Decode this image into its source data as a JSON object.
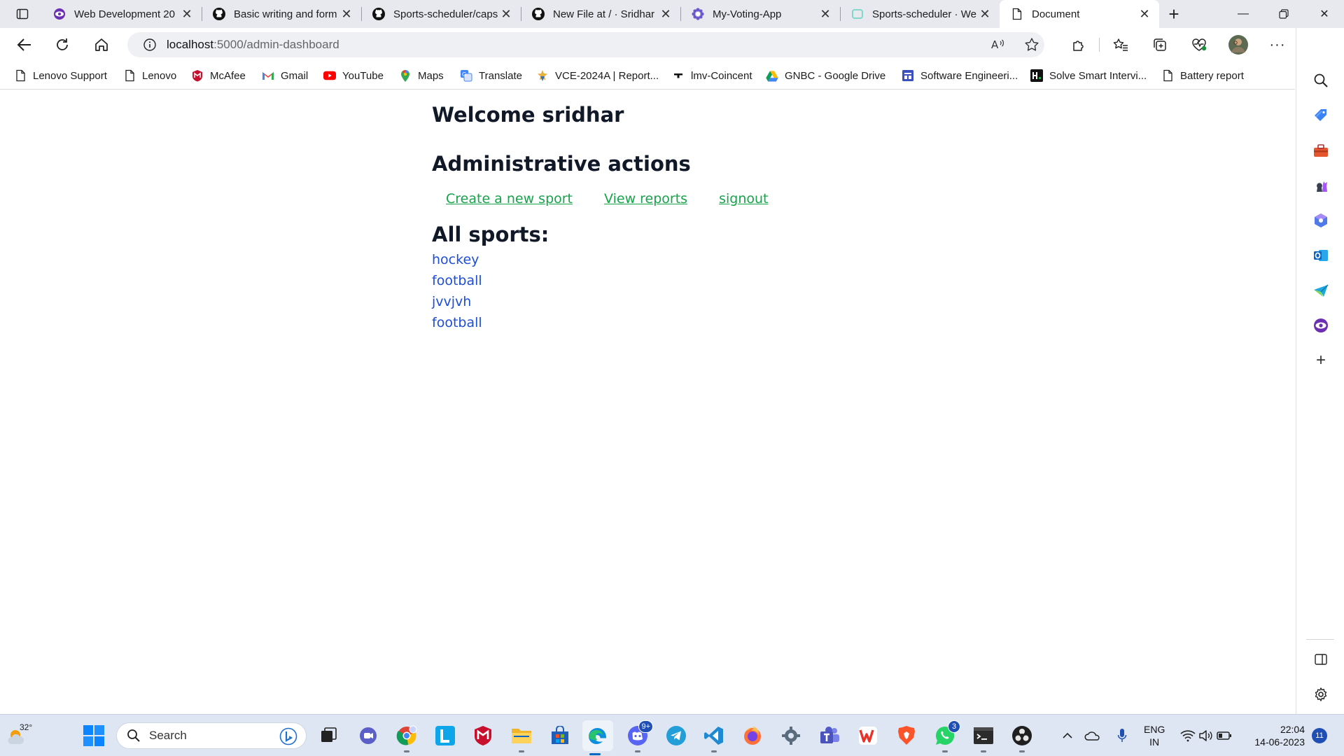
{
  "browser": {
    "tabs": [
      {
        "title": "Web Development 20",
        "icon": "eye-icon",
        "active": false
      },
      {
        "title": "Basic writing and form",
        "icon": "github-icon",
        "active": false
      },
      {
        "title": "Sports-scheduler/caps",
        "icon": "github-icon",
        "active": false
      },
      {
        "title": "New File at / · Sridhar",
        "icon": "github-icon",
        "active": false
      },
      {
        "title": "My-Voting-App",
        "icon": "gear-flower-icon",
        "active": false
      },
      {
        "title": "Sports-scheduler · We",
        "icon": "render-icon",
        "active": false
      },
      {
        "title": "Document",
        "icon": "page-icon",
        "active": true
      }
    ],
    "address": {
      "host": "localhost",
      "rest": ":5000/admin-dashboard"
    },
    "favorites": [
      {
        "label": "Lenovo Support",
        "icon": "page-icon"
      },
      {
        "label": "Lenovo",
        "icon": "page-icon"
      },
      {
        "label": "McAfee",
        "icon": "mcafee-icon"
      },
      {
        "label": "Gmail",
        "icon": "gmail-icon"
      },
      {
        "label": "YouTube",
        "icon": "youtube-icon"
      },
      {
        "label": "Maps",
        "icon": "maps-pin-icon"
      },
      {
        "label": "Translate",
        "icon": "translate-icon"
      },
      {
        "label": "VCE-2024A | Report...",
        "icon": "vce-icon"
      },
      {
        "label": "lmv-Coincent",
        "icon": "dash-icon"
      },
      {
        "label": "GNBC - Google Drive",
        "icon": "drive-icon"
      },
      {
        "label": "Software Engineeri...",
        "icon": "forms-icon"
      },
      {
        "label": "Solve Smart Intervi...",
        "icon": "hackerrank-icon"
      },
      {
        "label": "Battery report",
        "icon": "page-icon"
      }
    ]
  },
  "page": {
    "welcome": "Welcome sridhar",
    "admin_heading": "Administrative actions",
    "actions": [
      "Create a new sport",
      "View reports",
      "signout"
    ],
    "sports_heading": "All sports:",
    "sports": [
      "hockey",
      "football",
      "jvvjvh",
      "football"
    ]
  },
  "taskbar": {
    "weather": "32°",
    "search_label": "Search",
    "discord_badge": "9+",
    "whatsapp_badge": "3",
    "lang_line1": "ENG",
    "lang_line2": "IN",
    "time": "22:04",
    "date": "14-06-2023",
    "notifications": "11"
  },
  "colors": {
    "action_link": "#16a34a",
    "sport_link": "#1d4ed8",
    "heading": "#111827"
  }
}
